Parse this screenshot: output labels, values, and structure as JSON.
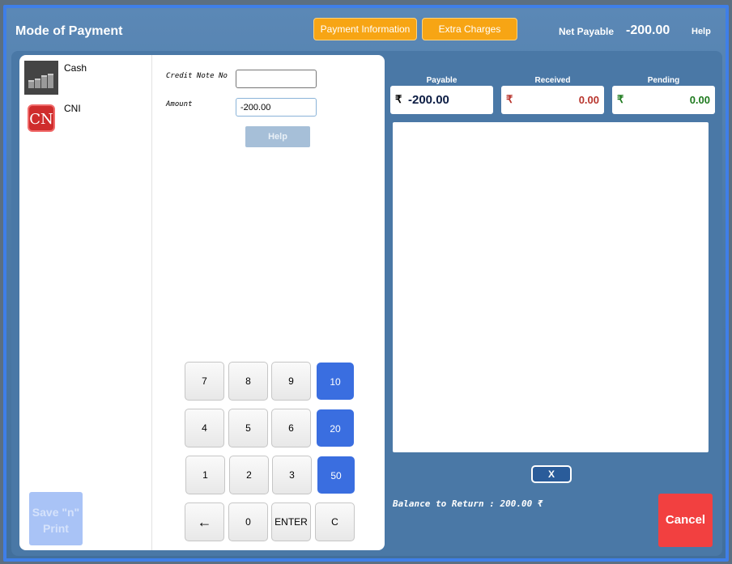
{
  "window": {
    "title": "Mode of Payment"
  },
  "header": {
    "payment_info_label": "Payment Information",
    "extra_charges_label": "Extra Charges",
    "net_payable_label": "Net Payable",
    "net_payable_value": "-200.00",
    "help_label": "Help"
  },
  "modes": [
    {
      "label": "Cash",
      "icon": "cash-coins-icon"
    },
    {
      "label": "CNI",
      "icon": "credit-note-icon",
      "icon_text": "CN"
    }
  ],
  "form": {
    "credit_note_label": "Credit Note No",
    "credit_note_value": "",
    "amount_label": "Amount",
    "amount_value": "-200.00",
    "help_label": "Help"
  },
  "keypad": {
    "rows": [
      [
        "7",
        "8",
        "9",
        "10"
      ],
      [
        "4",
        "5",
        "6",
        "20"
      ],
      [
        "1",
        "2",
        "3",
        "50"
      ],
      [
        "←",
        "0",
        "ENTER",
        "C"
      ]
    ]
  },
  "summary": {
    "payable_label": "Payable",
    "payable_value": "-200.00",
    "received_label": "Received",
    "received_value": "0.00",
    "pending_label": "Pending",
    "pending_value": "0.00",
    "currency": "₹"
  },
  "footer": {
    "save_print_label": "Save \"n\" Print",
    "x_label": "X",
    "balance_text": "Balance to Return : 200.00  ₹",
    "cancel_label": "Cancel"
  },
  "colors": {
    "accent_orange": "#f7a514",
    "keypad_blue": "#3a6ee0",
    "cancel_red": "#f24040",
    "received_red": "#b8342c",
    "pending_green": "#1e7a1e"
  }
}
